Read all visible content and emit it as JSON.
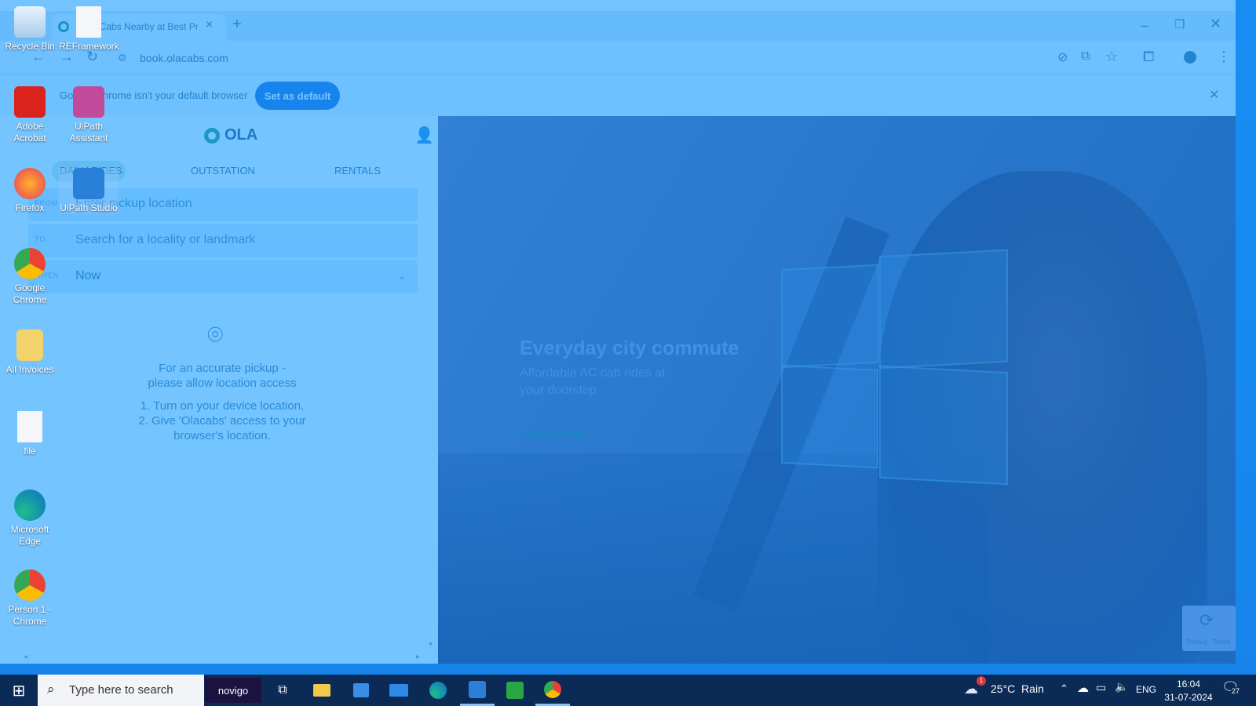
{
  "browser": {
    "tab_title": "Book Cabs Nearby at Best Price",
    "url": "book.olacabs.com",
    "infobar_text": "Google Chrome isn't your default browser",
    "set_default_label": "Set as default"
  },
  "ola": {
    "logo_text": "OLA",
    "tabs": [
      "DAILY RIDES",
      "OUTSTATION",
      "RENTALS"
    ],
    "from_label": "FROM",
    "from_placeholder": "Enter pickup location",
    "to_label": "TO",
    "to_placeholder": "Search for a locality or landmark",
    "when_label": "WHEN",
    "when_value": "Now",
    "location_msg_1": "For an accurate pickup -",
    "location_msg_2": "please allow location access",
    "step_1": "1. Turn on your device location.",
    "step_2a": "2. Give 'Olacabs' access to your",
    "step_2b": "browser's location."
  },
  "hero": {
    "title": "Everyday city commute",
    "subtitle_1": "Affordable AC cab rides at",
    "subtitle_2": "your doorstep",
    "hashtag": "#OlaForWeb",
    "recaptcha_text": "Privacy - Terms"
  },
  "desktop_icons": [
    {
      "label": "Recycle Bin",
      "icon": "recycle-bin-icon"
    },
    {
      "label": "REFramework",
      "icon": "file-icon"
    },
    {
      "label": "Adobe Acrobat",
      "icon": "acrobat-icon"
    },
    {
      "label": "UiPath Assistant",
      "icon": "uipath-assistant-icon"
    },
    {
      "label": "Firefox",
      "icon": "firefox-icon"
    },
    {
      "label": "UiPath Studio",
      "icon": "uipath-studio-icon"
    },
    {
      "label": "Google Chrome",
      "icon": "chrome-icon"
    },
    {
      "label": "All Invoices",
      "icon": "folder-icon"
    },
    {
      "label": "file",
      "icon": "file-icon"
    },
    {
      "label": "Microsoft Edge",
      "icon": "edge-icon"
    },
    {
      "label": "Person 1 - Chrome",
      "icon": "chrome-profile-icon"
    }
  ],
  "taskbar": {
    "search_placeholder": "Type here to search",
    "novigo_label": "novigo",
    "weather": "25°C  Rain",
    "weather_badge": "1",
    "language": "ENG",
    "time": "16:04",
    "date": "31-07-2024",
    "notification_count": "27"
  },
  "colors": {
    "ola_accent": "#2bb673",
    "set_default_bg": "#0b57d0",
    "taskbar_bg": "#0b2a55"
  }
}
